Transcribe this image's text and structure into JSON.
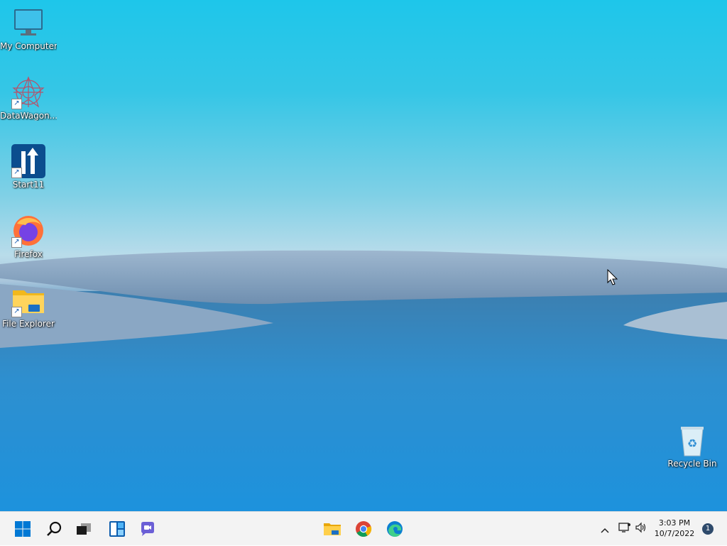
{
  "desktop": {
    "icons": [
      {
        "label": "My Computer"
      },
      {
        "label": "DataWagon..."
      },
      {
        "label": "Start11"
      },
      {
        "label": "Firefox"
      },
      {
        "label": "File Explorer"
      },
      {
        "label": "Recycle Bin"
      }
    ]
  },
  "taskbar": {
    "icons": [
      "windows-start-icon",
      "search-icon",
      "task-view-icon",
      "widgets-icon",
      "chat-icon",
      "file-explorer-icon",
      "chrome-icon",
      "edge-icon"
    ],
    "tray": {
      "time": "3:03 PM",
      "date": "10/7/2022",
      "notification_count": "1"
    }
  },
  "colors": {
    "taskbar_bg": "#f3f3f3",
    "windows_blue": "#0078d4"
  }
}
